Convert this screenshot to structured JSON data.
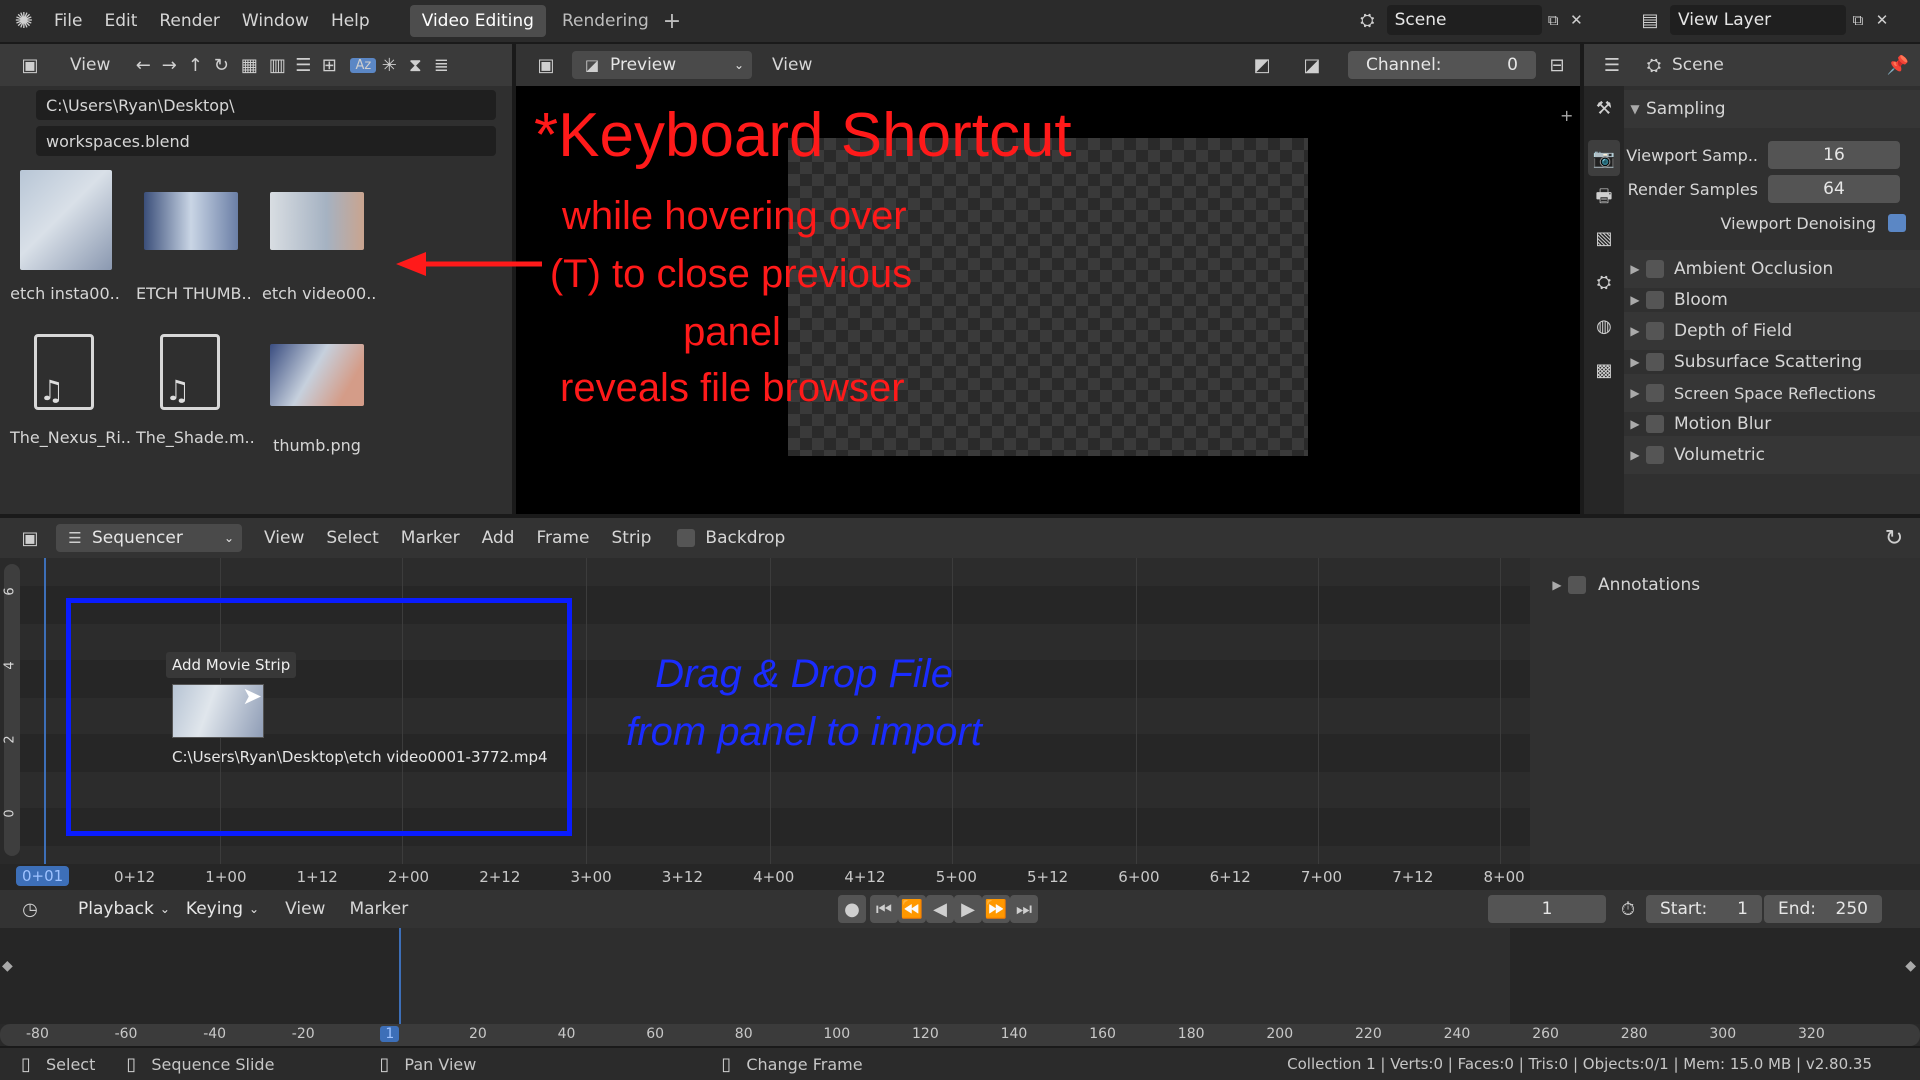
{
  "topbar": {
    "menus": [
      "File",
      "Edit",
      "Render",
      "Window",
      "Help"
    ],
    "workspace_tabs": [
      "Video Editing",
      "Rendering"
    ],
    "add_tab": "+",
    "scene_label": "Scene",
    "view_layer_label": "View Layer"
  },
  "file_browser": {
    "view_label": "View",
    "path": "C:\\Users\\Ryan\\Desktop\\",
    "filename": "workspaces.blend",
    "files": [
      {
        "name": "etch insta00..",
        "kind": "image"
      },
      {
        "name": "ETCH THUMB..",
        "kind": "image"
      },
      {
        "name": "etch video00..",
        "kind": "image"
      },
      {
        "name": "The_Nexus_Ri..",
        "kind": "audio"
      },
      {
        "name": "The_Shade.m..",
        "kind": "audio"
      },
      {
        "name": "thumb.png",
        "kind": "image"
      }
    ]
  },
  "preview": {
    "mode": "Preview",
    "view_label": "View",
    "channel_label": "Channel:",
    "channel_value": "0",
    "annotation_title": "*Keyboard Shortcut",
    "annotation_line1": "while hovering over",
    "annotation_line2": "(T) to close previous",
    "annotation_line3": "panel",
    "annotation_line4": "reveals file browser"
  },
  "properties": {
    "scene_label": "Scene",
    "sampling_label": "Sampling",
    "viewport_samples_label": "Viewport Samp..",
    "viewport_samples_value": "16",
    "render_samples_label": "Render Samples",
    "render_samples_value": "64",
    "viewport_denoising_label": "Viewport Denoising",
    "sections": [
      "Ambient Occlusion",
      "Bloom",
      "Depth of Field",
      "Subsurface Scattering",
      "Screen Space Reflections",
      "Motion Blur",
      "Volumetric"
    ]
  },
  "sequencer": {
    "editor_label": "Sequencer",
    "menus": [
      "View",
      "Select",
      "Marker",
      "Add",
      "Frame",
      "Strip"
    ],
    "backdrop_label": "Backdrop",
    "channel_numbers": [
      "6",
      "4",
      "2",
      "0"
    ],
    "tooltip": "Add Movie Strip",
    "strip_path": "C:\\Users\\Ryan\\Desktop\\etch video0001-3772.mp4",
    "annotation_line1": "Drag & Drop File",
    "annotation_line2": "from panel to import",
    "annotations_label": "Annotations",
    "current_time": "0+01",
    "ruler": [
      "0+12",
      "1+00",
      "1+12",
      "2+00",
      "2+12",
      "3+00",
      "3+12",
      "4+00",
      "4+12",
      "5+00",
      "5+12",
      "6+00",
      "6+12",
      "7+00",
      "7+12",
      "8+00"
    ]
  },
  "timeline": {
    "playback_label": "Playback",
    "keying_label": "Keying",
    "view_label": "View",
    "marker_label": "Marker",
    "current_frame": "1",
    "start_label": "Start:",
    "start_value": "1",
    "end_label": "End:",
    "end_value": "250",
    "ruler": [
      "-80",
      "-60",
      "-40",
      "-20",
      "1",
      "20",
      "40",
      "60",
      "80",
      "100",
      "120",
      "140",
      "160",
      "180",
      "200",
      "220",
      "240",
      "260",
      "280",
      "300",
      "320"
    ]
  },
  "statusbar": {
    "select": "Select",
    "sequence_slide": "Sequence Slide",
    "pan_view": "Pan View",
    "change_frame": "Change Frame",
    "stats": "Collection 1 | Verts:0 | Faces:0 | Tris:0 | Objects:0/1 | Mem: 15.0 MB | v2.80.35"
  },
  "colors": {
    "accent": "#5b87c5",
    "annotation_red": "#ff1a1a",
    "annotation_blue": "#1a2cff"
  }
}
